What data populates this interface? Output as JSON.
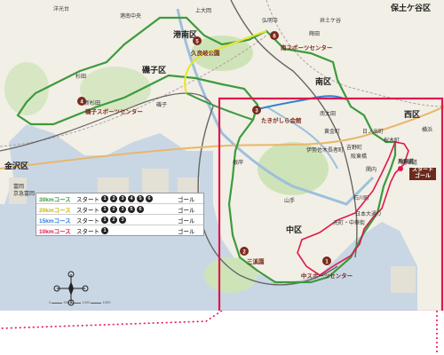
{
  "places": {
    "hodogaya_ward": "保土ケ谷区",
    "minami_ward": "港南区",
    "isogo_ward": "磯子区",
    "kanazawa_ward": "金沢区",
    "minami_ku": "南区",
    "nishi_ward": "西区",
    "naka_ward": "中区"
  },
  "stations": [
    "洋光台",
    "上大岡",
    "井土ケ谷",
    "弘明寺",
    "港南中央",
    "杉田",
    "新杉田",
    "磯子",
    "根岸",
    "蒔田",
    "吉野町",
    "阪東橋",
    "関内",
    "石川町",
    "日本大通り",
    "元町・中華街",
    "横浜",
    "桜木町",
    "馬車道",
    "富岡",
    "京急富岡",
    "南太田",
    "黄金町",
    "日ノ出町",
    "伊勢佐木長者町",
    "山手"
  ],
  "markers": [
    {
      "num": "1",
      "label": "中スポーツセンター"
    },
    {
      "num": "2",
      "label": "三溪園"
    },
    {
      "num": "3",
      "label": "たきがしら会館"
    },
    {
      "num": "4",
      "label": "磯子スポーツセンター"
    },
    {
      "num": "5",
      "label": "久良岐公園"
    },
    {
      "num": "6",
      "label": "南スポーツセンター"
    }
  ],
  "start_goal": {
    "line1": "スタート",
    "line2": "ゴール",
    "station": "馬車道"
  },
  "legend": [
    {
      "name": "30kmコース",
      "start": "スタート",
      "stops": [
        "1",
        "2",
        "3",
        "4",
        "5",
        "6"
      ],
      "goal": "ゴール",
      "color": "#3c9b3c"
    },
    {
      "name": "20kmコース",
      "start": "スタート",
      "stops": [
        "1",
        "2",
        "3",
        "5",
        "6"
      ],
      "goal": "ゴール",
      "color": "#d6d600"
    },
    {
      "name": "15kmコース",
      "start": "スタート",
      "stops": [
        "1",
        "2",
        "3"
      ],
      "goal": "ゴール",
      "color": "#2d7fd1"
    },
    {
      "name": "10kmコース",
      "start": "スタート",
      "stops": [
        "1"
      ],
      "goal": "ゴール",
      "color": "#e0174e"
    }
  ],
  "scale": {
    "labels": [
      "0",
      "500",
      "1000",
      "1500"
    ]
  }
}
